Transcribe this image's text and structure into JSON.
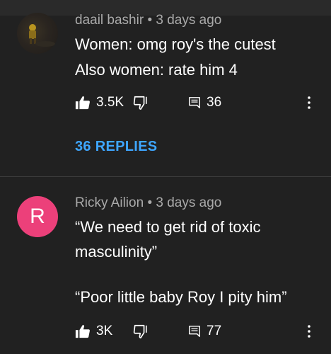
{
  "comments": [
    {
      "author": "daail bashir",
      "separator": "•",
      "time": "3 days ago",
      "lines": [
        "Women: omg roy's the cutest",
        "Also women: rate him 4"
      ],
      "likes": "3.5K",
      "reply_count": "36",
      "replies_label": "36 REPLIES"
    },
    {
      "author": "Ricky Ailion",
      "separator": "•",
      "time": "3 days ago",
      "avatar_letter": "R",
      "lines": [
        "“We need to get rid of toxic",
        "masculinity”",
        "",
        "“Poor little baby Roy I pity him”"
      ],
      "likes": "3K",
      "reply_count": "77"
    }
  ],
  "icons": {
    "like": "thumb-up-icon",
    "dislike": "thumb-down-icon",
    "reply": "comment-icon",
    "menu": "more-vertical-icon"
  },
  "colors": {
    "background": "#212121",
    "meta_text": "#aaaaaa",
    "replies_link": "#3ea6ff",
    "avatar_r": "#ec407a"
  }
}
